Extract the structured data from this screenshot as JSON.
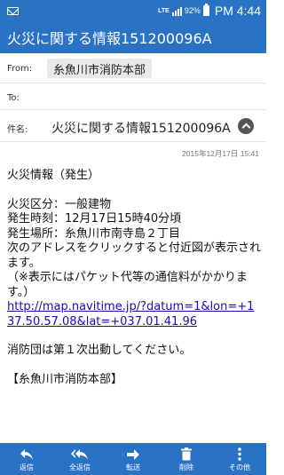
{
  "status_bar": {
    "network_label": "LTE",
    "battery_percent": "92%",
    "time": "PM 4:44"
  },
  "title_bar": {
    "title": "火災に関する情報151200096A"
  },
  "header": {
    "from_label": "From:",
    "from_value": "糸魚川市消防本部",
    "to_label": "To:",
    "to_value": "",
    "subject_label": "件名:",
    "subject_value": "火災に関する情報151200096A"
  },
  "mail": {
    "date": "2015年12月17日 15:41",
    "body": {
      "heading": "火災情報（発生）",
      "category": "火災区分：一般建物",
      "occurred_time": "発生時刻：12月17日15時40分頃",
      "location": "発生場所：糸魚川市南寺島２丁目",
      "instruction": "次のアドレスをクリックすると付近図が表示されます。",
      "note": "（※表示にはパケット代等の通信料がかかります。）",
      "link": "http://map.navitime.jp/?datum=1&lon=+137.50.57.08&lat=+037.01.41.96",
      "dispatch": "消防団は第１次出動してください。",
      "signature": "【糸魚川市消防本部】"
    }
  },
  "toolbar": {
    "items": [
      {
        "label": "返信",
        "icon": "reply-icon"
      },
      {
        "label": "全返信",
        "icon": "reply-all-icon"
      },
      {
        "label": "転送",
        "icon": "forward-icon"
      },
      {
        "label": "削除",
        "icon": "trash-icon"
      },
      {
        "label": "その他",
        "icon": "more-icon"
      }
    ]
  },
  "colors": {
    "accent": "#2a73c4",
    "link": "#1a0dab"
  }
}
